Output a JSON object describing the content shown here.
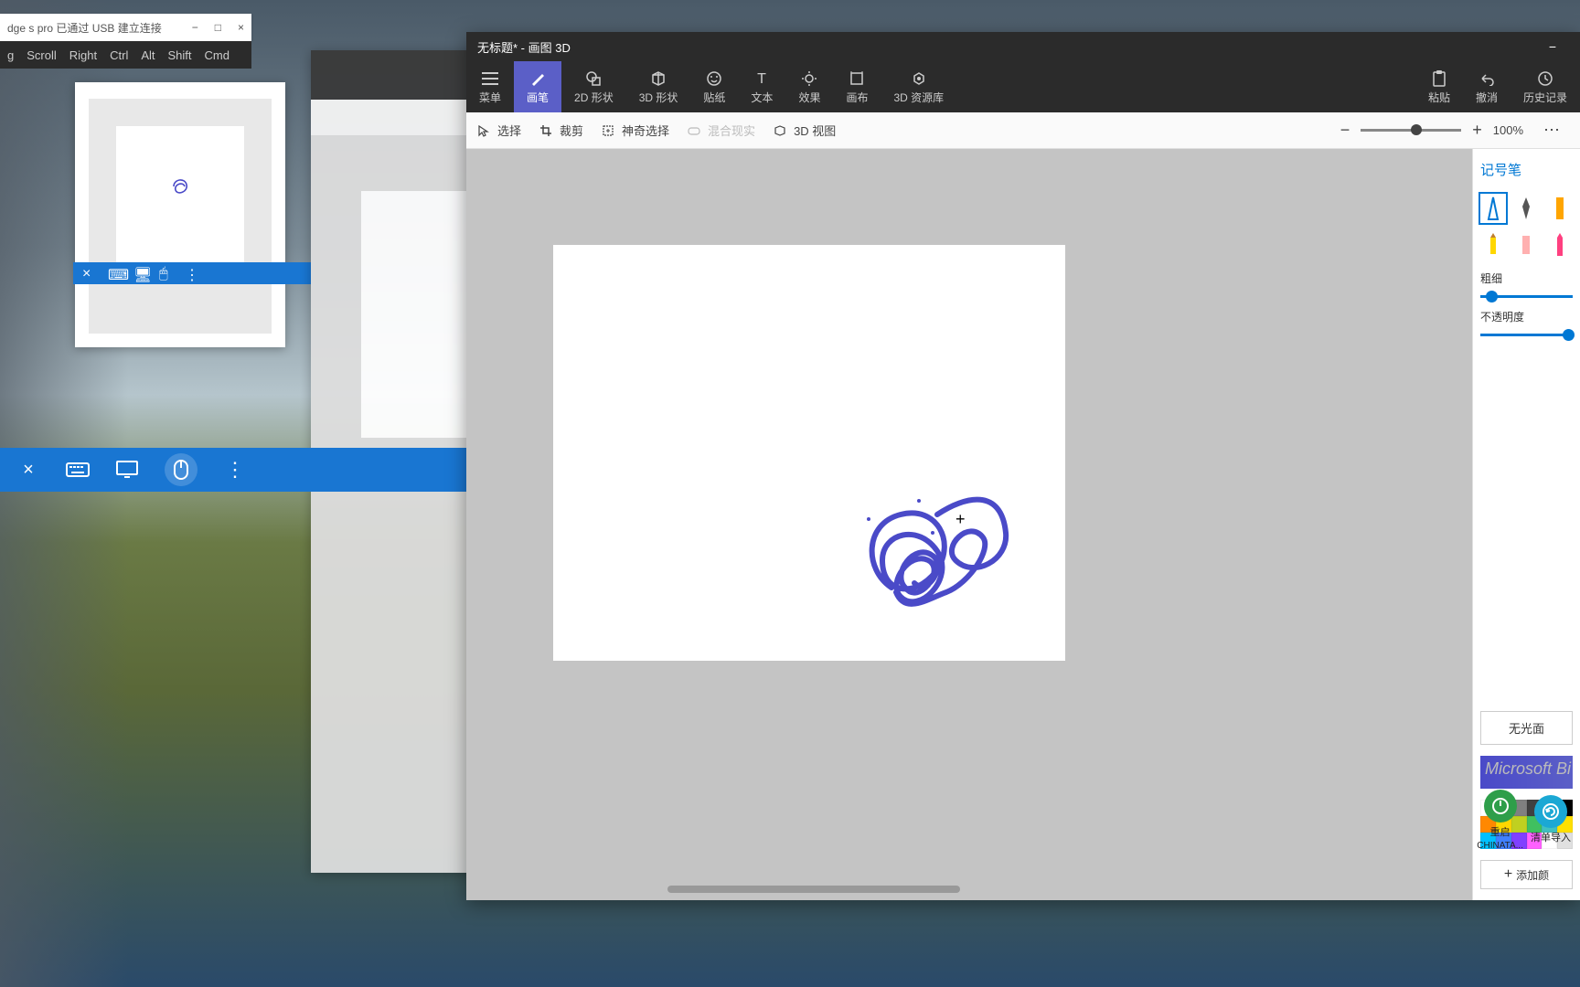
{
  "remote_titlebar": {
    "title": "dge s pro 已通过 USB 建立连接",
    "minimize": "−",
    "maximize": "□",
    "close": "×"
  },
  "remote_shortcuts": {
    "g": "g",
    "scroll": "Scroll",
    "right": "Right",
    "ctrl": "Ctrl",
    "alt": "Alt",
    "shift": "Shift",
    "cmd": "Cmd"
  },
  "blue_toolbar": {
    "close": "×",
    "keyboard": "⌨",
    "screen": "🖥",
    "mouse": "🖱",
    "more": "⋮"
  },
  "paint3d": {
    "title": "无标题* - 画图 3D",
    "minimize": "−",
    "toolbar": {
      "menu": "菜单",
      "brush": "画笔",
      "shape2d": "2D 形状",
      "shape3d": "3D 形状",
      "sticker": "贴纸",
      "text": "文本",
      "effect": "效果",
      "canvas": "画布",
      "library": "3D 资源库",
      "paste": "粘贴",
      "undo": "撤消",
      "history": "历史记录"
    },
    "subbar": {
      "select": "选择",
      "crop": "裁剪",
      "magic": "神奇选择",
      "mixed": "混合现实",
      "view3d": "3D 视图",
      "zoom_minus": "−",
      "zoom_plus": "+",
      "zoom_value": "100%",
      "more": "⋯"
    },
    "sidebar": {
      "title": "记号笔",
      "thickness_label": "粗细",
      "opacity_label": "不透明度",
      "finish": "无光面",
      "add_color": "添加颜"
    }
  },
  "colors": {
    "stroke": "#4a4ac8",
    "palette": [
      "#ffffff",
      "#c0c0c0",
      "#808080",
      "#404040",
      "#000000",
      "#000000",
      "#ff8800",
      "#ffd700",
      "#c0d020",
      "#40c060",
      "#40c0c0",
      "#3060ff",
      "#00c0ff",
      "#ff60ff",
      "#8040ff",
      "#4040a0",
      "#ff4040",
      "#e0e060"
    ]
  },
  "taskbar": {
    "bing": "Microsoft Bi",
    "restart": "重启",
    "chinata": "CHINATA...",
    "clear_import": "清单导入"
  }
}
